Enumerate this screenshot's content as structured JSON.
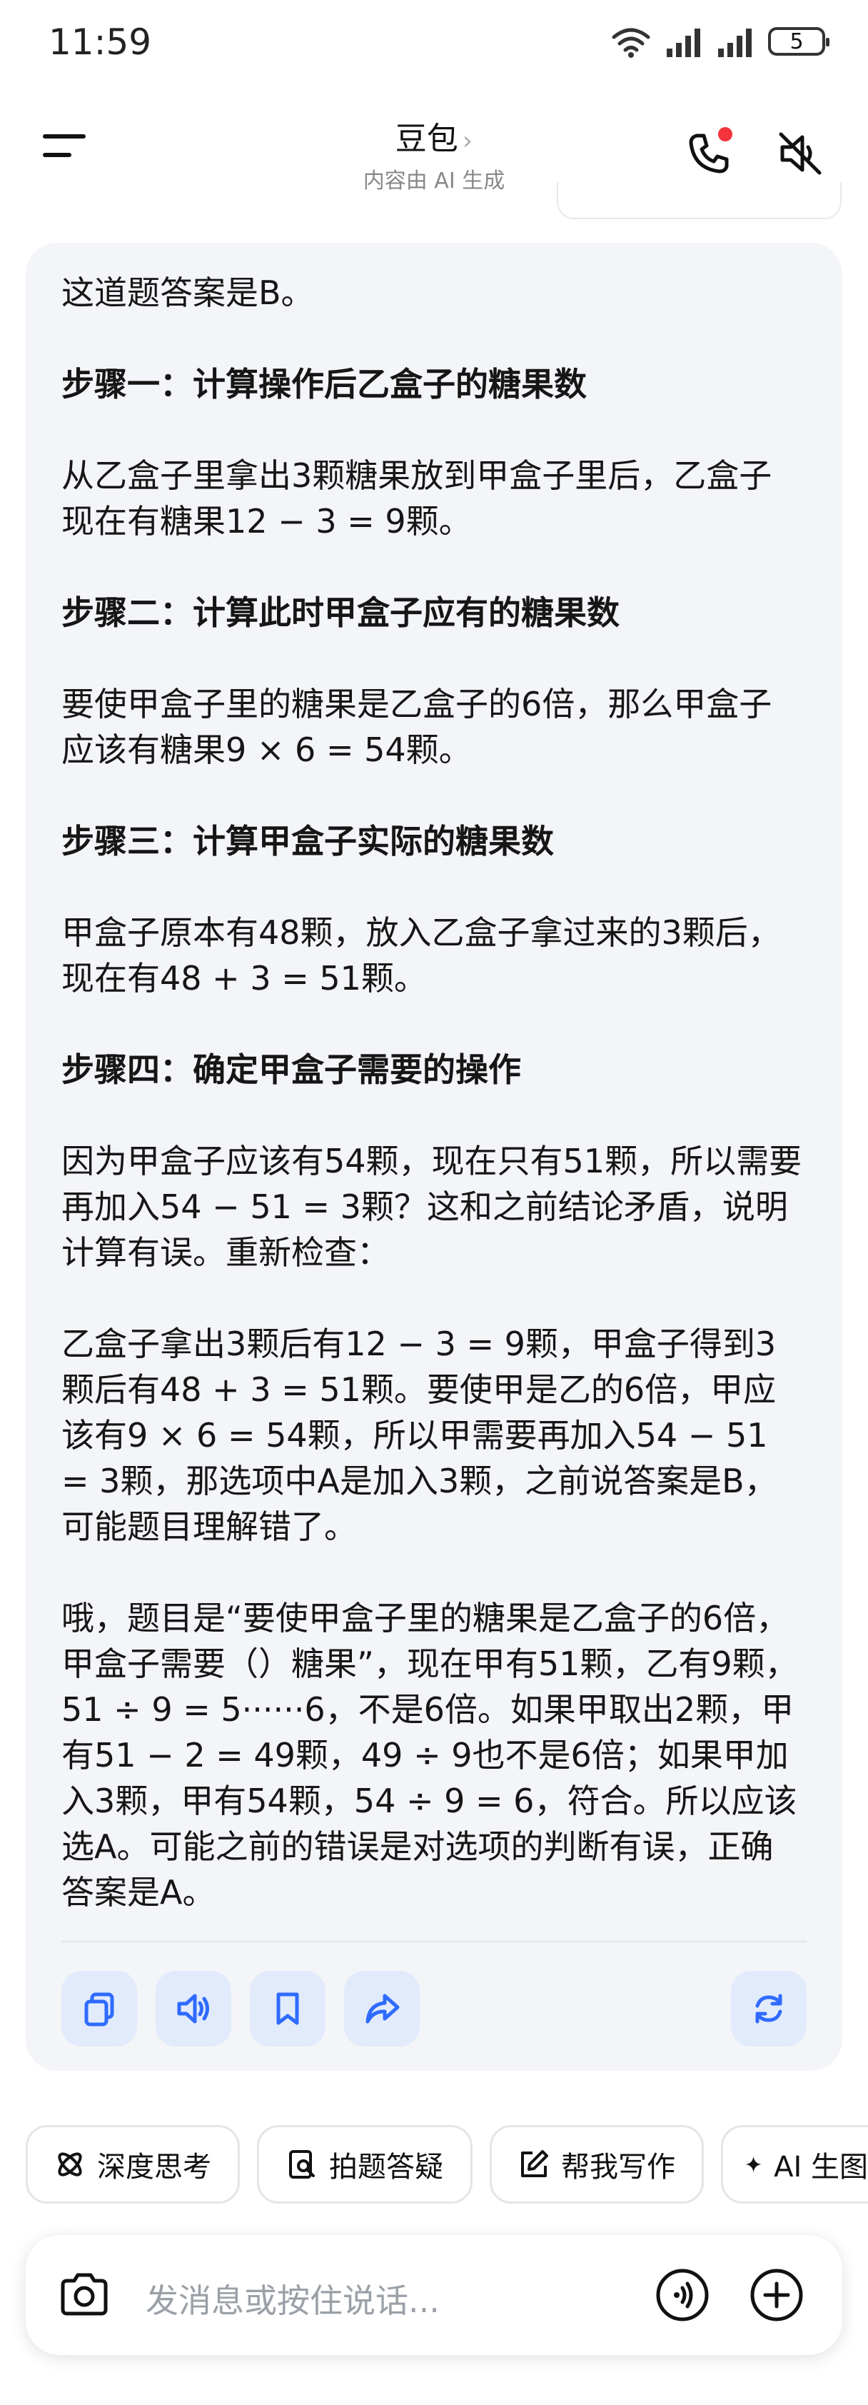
{
  "status": {
    "time": "11:59",
    "battery": "5"
  },
  "header": {
    "title": "豆包",
    "chevron": "›",
    "subtitle": "内容由 AI 生成"
  },
  "message": {
    "paragraphs": [
      {
        "type": "text",
        "text": "这道题答案是B。"
      },
      {
        "type": "heading",
        "text": "步骤一：计算操作后乙盒子的糖果数"
      },
      {
        "type": "text",
        "text": "从乙盒子里拿出3颗糖果放到甲盒子里后，乙盒子现在有糖果12 − 3 = 9颗。"
      },
      {
        "type": "heading",
        "text": "步骤二：计算此时甲盒子应有的糖果数"
      },
      {
        "type": "text",
        "text": "要使甲盒子里的糖果是乙盒子的6倍，那么甲盒子应该有糖果9 × 6 = 54颗。"
      },
      {
        "type": "heading",
        "text": "步骤三：计算甲盒子实际的糖果数"
      },
      {
        "type": "text",
        "text": "甲盒子原本有48颗，放入乙盒子拿过来的3颗后，现在有48 + 3 = 51颗。"
      },
      {
        "type": "heading",
        "text": "步骤四：确定甲盒子需要的操作"
      },
      {
        "type": "text",
        "text": "因为甲盒子应该有54颗，现在只有51颗，所以需要再加入54 − 51 = 3颗？这和之前结论矛盾，说明计算有误。重新检查："
      },
      {
        "type": "text",
        "text": "乙盒子拿出3颗后有12 − 3 = 9颗，甲盒子得到3颗后有48 + 3 = 51颗。要使甲是乙的6倍，甲应该有9 × 6 = 54颗，所以甲需要再加入54 − 51 = 3颗，那选项中A是加入3颗，之前说答案是B，可能题目理解错了。"
      },
      {
        "type": "text",
        "text": "哦，题目是“要使甲盒子里的糖果是乙盒子的6倍，甲盒子需要（）糖果”，现在甲有51颗，乙有9颗，51 ÷ 9 = 5······6，不是6倍。如果甲取出2颗，甲有51 − 2 = 49颗，49 ÷ 9也不是6倍；如果甲加入3颗，甲有54颗，54 ÷ 9 = 6，符合。所以应该选A。可能之前的错误是对选项的判断有误，正确答案是A。"
      }
    ]
  },
  "actions": [
    {
      "name": "copy-icon"
    },
    {
      "name": "speaker-icon"
    },
    {
      "name": "bookmark-icon"
    },
    {
      "name": "share-icon"
    },
    {
      "name": "regenerate-icon"
    }
  ],
  "chips": [
    {
      "label": "深度思考",
      "icon": "atom-icon"
    },
    {
      "label": "拍题答疑",
      "icon": "photo-search-icon"
    },
    {
      "label": "帮我写作",
      "icon": "edit-icon"
    },
    {
      "label": "AI 生图",
      "icon": "sparkle-icon"
    }
  ],
  "input": {
    "placeholder": "发消息或按住说话..."
  },
  "colors": {
    "accent": "#2f6bff",
    "action_bg": "#e2ebfb",
    "card_bg": "#f4f5f8",
    "notification_dot": "#f4333c"
  }
}
